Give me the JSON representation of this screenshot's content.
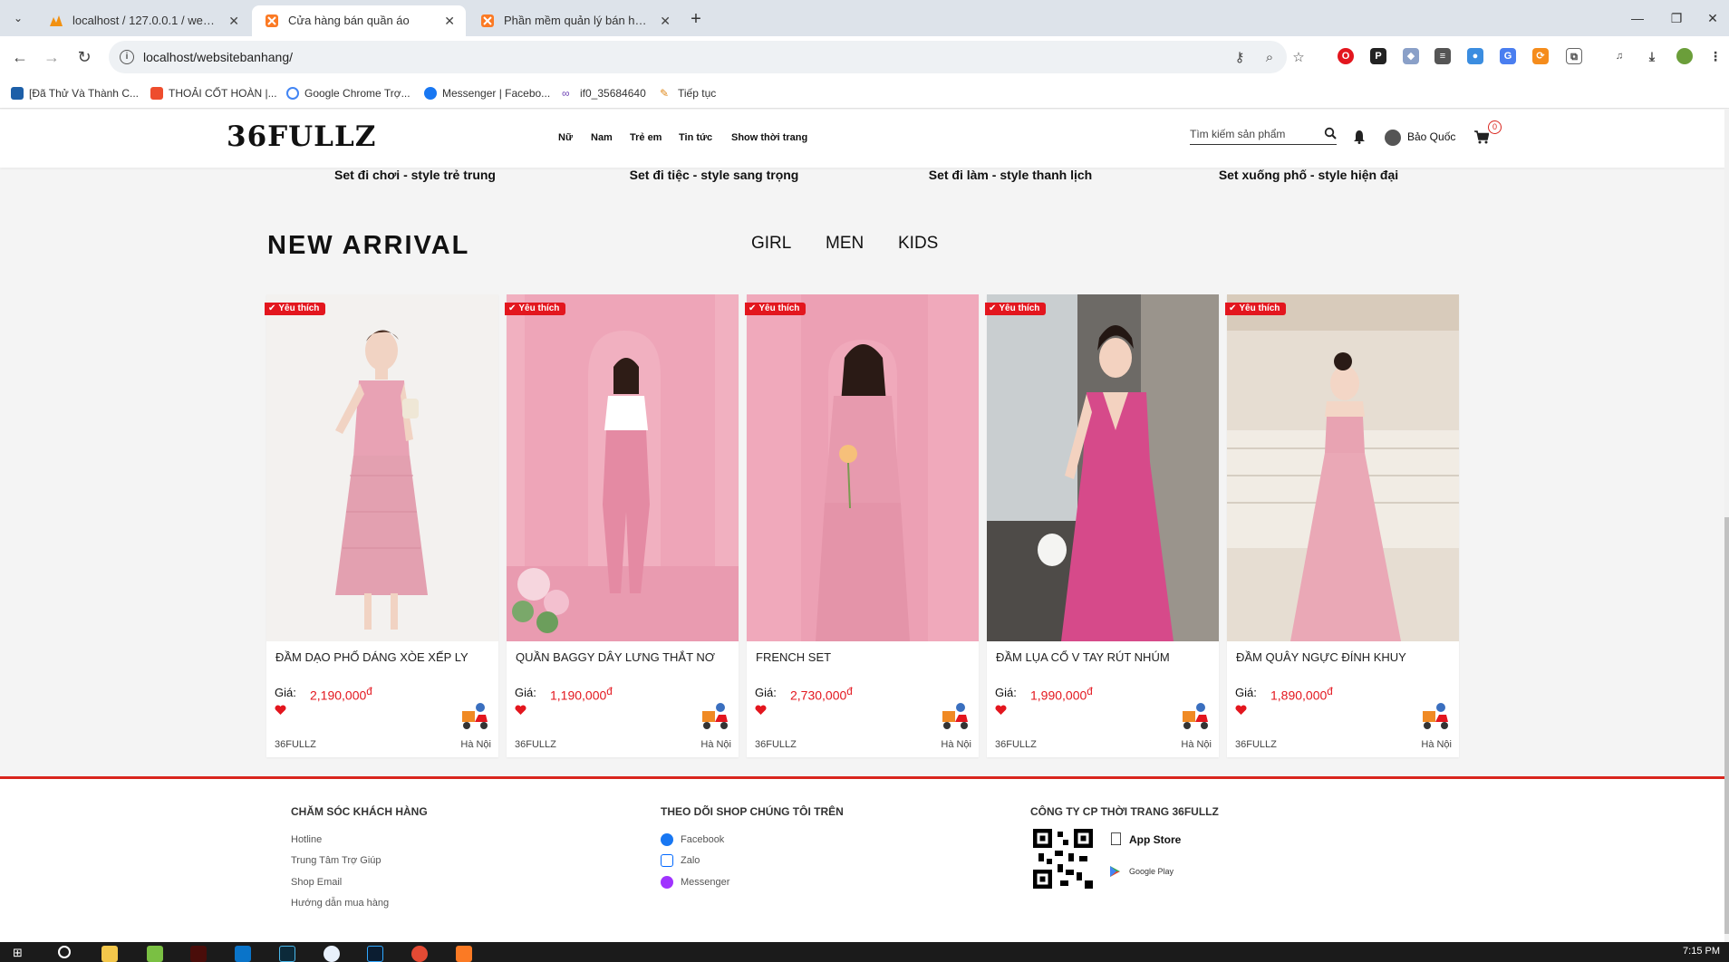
{
  "browser": {
    "tabs": [
      {
        "title": "localhost / 127.0.0.1 / web_ban",
        "active": false
      },
      {
        "title": "Cửa hàng bán quần áo",
        "active": true
      },
      {
        "title": "Phần mềm quản lý bán hàng",
        "active": false
      }
    ],
    "url": "localhost/websitebanhang/",
    "bookmarks": [
      "[Đã Thử Và Thành C...",
      "THOẢI CỐT HOÀN |...",
      "Google Chrome Trợ...",
      "Messenger | Facebo...",
      "if0_35684640",
      "Tiếp tục"
    ]
  },
  "header": {
    "logo": "36FULLZ",
    "nav": [
      "Nữ",
      "Nam",
      "Trẻ em",
      "Tin tức",
      "Show thời trang"
    ],
    "search_placeholder": "Tìm kiếm sản phẩm",
    "username": "Bảo Quốc",
    "cart_count": "0"
  },
  "style_sets": [
    "Set đi chơi - style trẻ trung",
    "Set đi tiệc - style sang trọng",
    "Set đi làm - style thanh lịch",
    "Set xuống phố - style hiện đại"
  ],
  "section": {
    "title": "NEW ARRIVAL",
    "categories": [
      "GIRL",
      "MEN",
      "KIDS"
    ]
  },
  "products": [
    {
      "badge": "Yêu thích",
      "name": "ĐẦM DẠO PHỐ DÁNG XÒE XẾP LY",
      "price_label": "Giá:",
      "price": "2,190,000",
      "currency": "đ",
      "shop": "36FULLZ",
      "location": "Hà Nội"
    },
    {
      "badge": "Yêu thích",
      "name": "QUẦN BAGGY DÂY LƯNG THẮT NƠ",
      "price_label": "Giá:",
      "price": "1,190,000",
      "currency": "đ",
      "shop": "36FULLZ",
      "location": "Hà Nội"
    },
    {
      "badge": "Yêu thích",
      "name": "FRENCH SET",
      "price_label": "Giá:",
      "price": "2,730,000",
      "currency": "đ",
      "shop": "36FULLZ",
      "location": "Hà Nội"
    },
    {
      "badge": "Yêu thích",
      "name": "ĐẦM LỤA CỔ V TAY RÚT NHÚM",
      "price_label": "Giá:",
      "price": "1,990,000",
      "currency": "đ",
      "shop": "36FULLZ",
      "location": "Hà Nội"
    },
    {
      "badge": "Yêu thích",
      "name": "ĐẦM QUÂY NGỰC ĐÍNH KHUY",
      "price_label": "Giá:",
      "price": "1,890,000",
      "currency": "đ",
      "shop": "36FULLZ",
      "location": "Hà Nội"
    }
  ],
  "footer": {
    "care": {
      "title": "CHĂM SÓC KHÁCH HÀNG",
      "links": [
        "Hotline",
        "Trung Tâm Trợ Giúp",
        "Shop Email",
        "Hướng dẫn mua hàng"
      ]
    },
    "follow": {
      "title": "THEO DÕI SHOP CHÚNG TÔI TRÊN",
      "links": [
        "Facebook",
        "Zalo",
        "Messenger"
      ]
    },
    "company": {
      "title": "CÔNG TY CP THỜI TRANG 36FULLZ",
      "app_store": "App Store",
      "google_play": "Google Play"
    }
  },
  "taskbar": {
    "clock": "7:15 PM"
  },
  "colors": {
    "accent_red": "#e3161e",
    "footer_border": "#d9251d",
    "dress_pink": "#e8a2b4",
    "magenta_dress": "#d64a8a"
  }
}
